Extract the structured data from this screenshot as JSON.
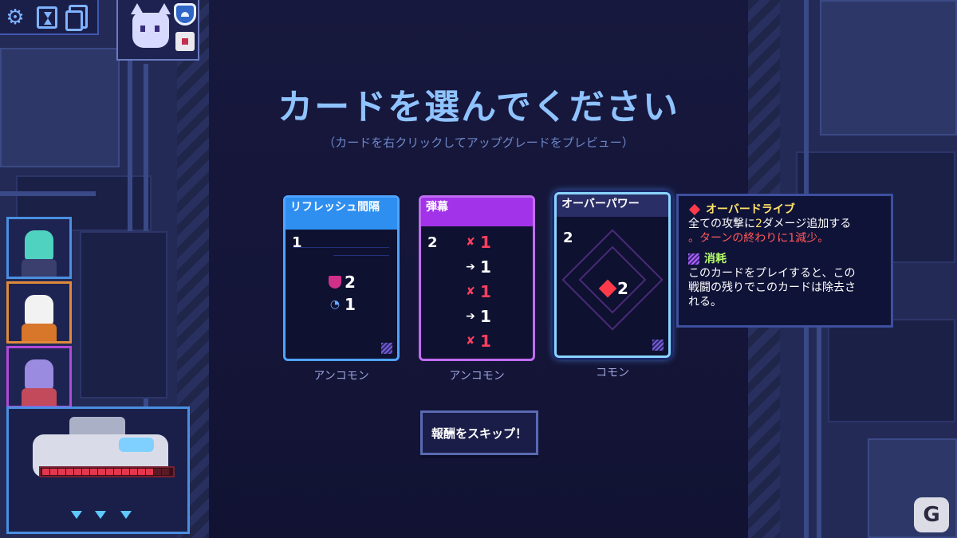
{
  "title": "カードを選んでください",
  "subtitle": "（カードを右クリックしてアップグレードをプレビュー）",
  "hud": {
    "icons": [
      "gear-icon",
      "hourglass-icon",
      "deck-icon"
    ]
  },
  "cards": [
    {
      "name": "リフレッシュ間隔",
      "cost": "1",
      "rarity": "アンコモン",
      "effects": [
        {
          "icon": "shield-icon",
          "value": "2"
        },
        {
          "icon": "clock-icon",
          "value": "1"
        }
      ]
    },
    {
      "name": "弾幕",
      "cost": "2",
      "rarity": "アンコモン",
      "effects": [
        {
          "icon": "attack-icon",
          "value": "1"
        },
        {
          "icon": "move-icon",
          "value": "1"
        },
        {
          "icon": "attack-icon",
          "value": "1"
        },
        {
          "icon": "move-icon",
          "value": "1"
        },
        {
          "icon": "attack-icon",
          "value": "1"
        }
      ]
    },
    {
      "name": "オーバーパワー",
      "cost": "2",
      "rarity": "コモン",
      "effects": [
        {
          "icon": "overdrive-icon",
          "value": "2"
        }
      ]
    }
  ],
  "tooltip": {
    "heading1": "オーバードライブ",
    "line1a": "全ての攻撃に",
    "line1b": "2",
    "line1c": "ダメージ追加する",
    "line2": "。ターンの終わりに1減少。",
    "heading2": "消耗",
    "line3": "このカードをプレイすると、この",
    "line4": "戦闘の残りでこのカードは除去さ",
    "line5": "れる。"
  },
  "skip_button": "報酬をスキップ！",
  "ship": {
    "hull": 0.89
  },
  "watermark": "G",
  "colors": {
    "title": "#8fc3ff",
    "card_blue": "#2e8ff0",
    "card_magenta": "#a233e8",
    "hull_red": "#e2374f"
  }
}
